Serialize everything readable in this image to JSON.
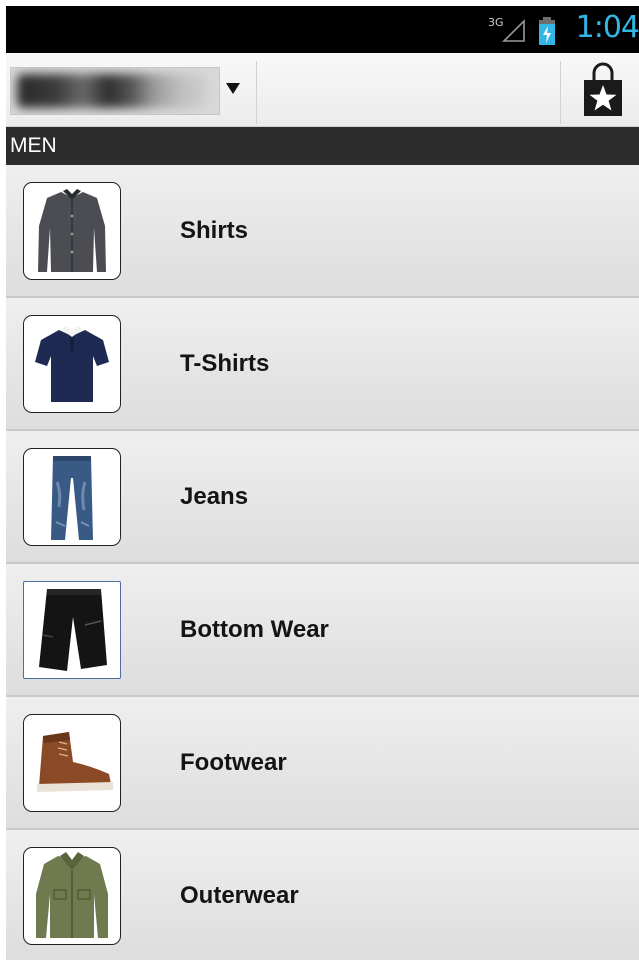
{
  "status_bar": {
    "network": "3G",
    "time": "1:04",
    "time_color": "#33b5e5"
  },
  "action_bar": {
    "spinner_icon": "chevron-down-icon",
    "shopping_bag_icon": "shopping-bag-star-icon"
  },
  "section": {
    "title": "MEN"
  },
  "categories": [
    {
      "label": "Shirts",
      "icon": "shirt-icon"
    },
    {
      "label": "T-Shirts",
      "icon": "tshirt-icon"
    },
    {
      "label": "Jeans",
      "icon": "jeans-icon"
    },
    {
      "label": "Bottom Wear",
      "icon": "shorts-icon"
    },
    {
      "label": "Footwear",
      "icon": "boot-icon"
    },
    {
      "label": "Outerwear",
      "icon": "jacket-icon"
    }
  ]
}
